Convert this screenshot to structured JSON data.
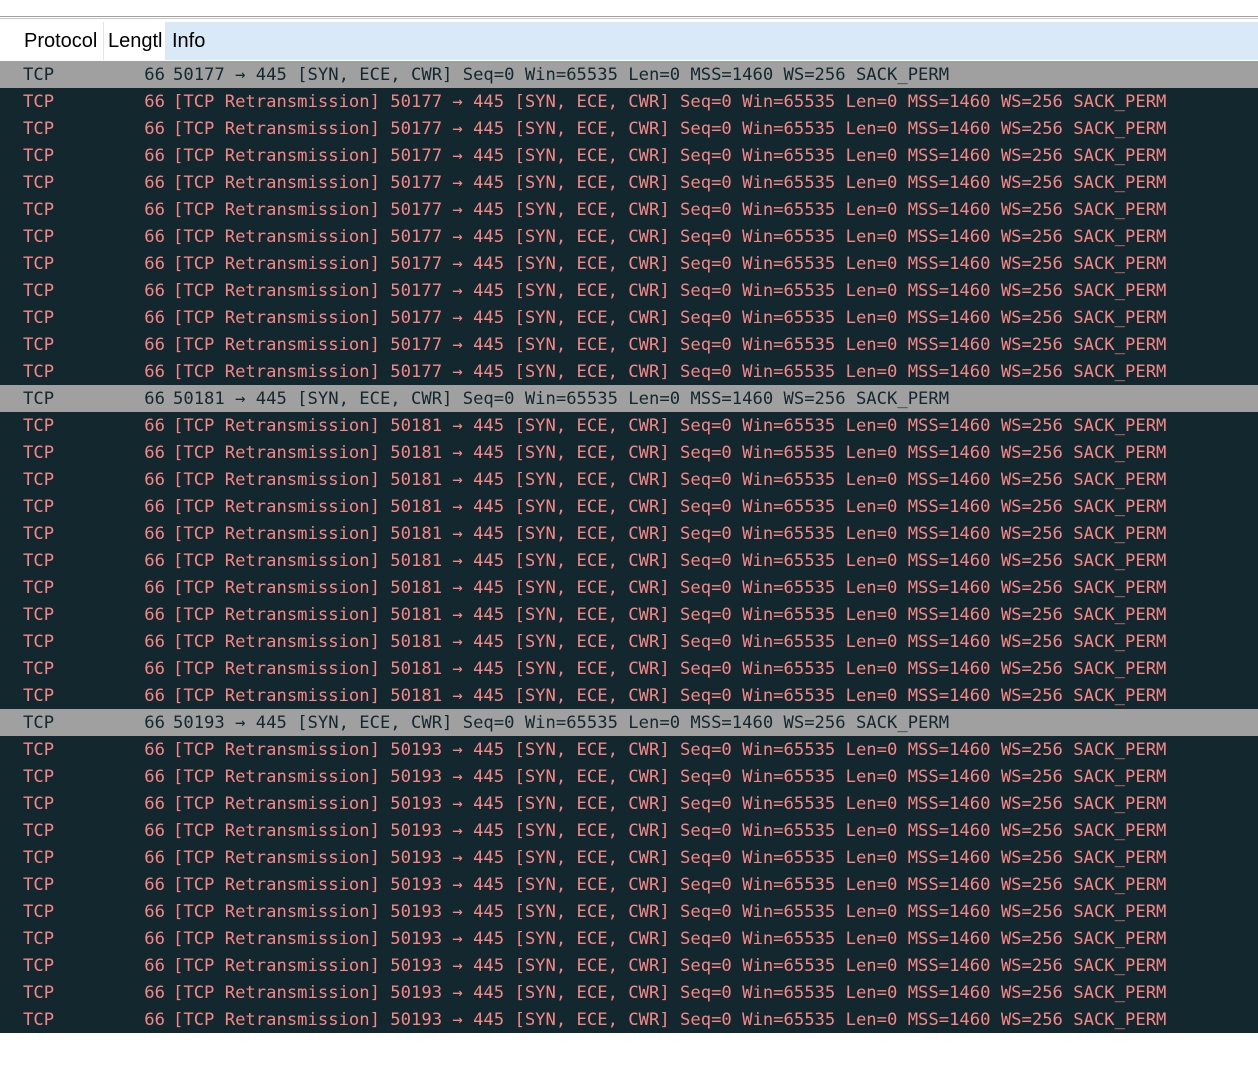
{
  "columns": {
    "protocol": "Protocol",
    "length": "Lengtl",
    "info": "Info"
  },
  "colors": {
    "retransmission_bg": "#12272e",
    "retransmission_fg": "#f78787",
    "normal_bg": "#a0a0a0",
    "normal_fg": "#12272e",
    "header_bg": "#d9e9f7"
  },
  "packets": [
    {
      "type": "syn",
      "protocol": "TCP",
      "length": "66",
      "info": "50177 → 445 [SYN, ECE, CWR] Seq=0 Win=65535 Len=0 MSS=1460 WS=256 SACK_PERM"
    },
    {
      "type": "retrans",
      "protocol": "TCP",
      "length": "66",
      "info": "[TCP Retransmission] 50177 → 445 [SYN, ECE, CWR] Seq=0 Win=65535 Len=0 MSS=1460 WS=256 SACK_PERM"
    },
    {
      "type": "retrans",
      "protocol": "TCP",
      "length": "66",
      "info": "[TCP Retransmission] 50177 → 445 [SYN, ECE, CWR] Seq=0 Win=65535 Len=0 MSS=1460 WS=256 SACK_PERM"
    },
    {
      "type": "retrans",
      "protocol": "TCP",
      "length": "66",
      "info": "[TCP Retransmission] 50177 → 445 [SYN, ECE, CWR] Seq=0 Win=65535 Len=0 MSS=1460 WS=256 SACK_PERM"
    },
    {
      "type": "retrans",
      "protocol": "TCP",
      "length": "66",
      "info": "[TCP Retransmission] 50177 → 445 [SYN, ECE, CWR] Seq=0 Win=65535 Len=0 MSS=1460 WS=256 SACK_PERM"
    },
    {
      "type": "retrans",
      "protocol": "TCP",
      "length": "66",
      "info": "[TCP Retransmission] 50177 → 445 [SYN, ECE, CWR] Seq=0 Win=65535 Len=0 MSS=1460 WS=256 SACK_PERM"
    },
    {
      "type": "retrans",
      "protocol": "TCP",
      "length": "66",
      "info": "[TCP Retransmission] 50177 → 445 [SYN, ECE, CWR] Seq=0 Win=65535 Len=0 MSS=1460 WS=256 SACK_PERM"
    },
    {
      "type": "retrans",
      "protocol": "TCP",
      "length": "66",
      "info": "[TCP Retransmission] 50177 → 445 [SYN, ECE, CWR] Seq=0 Win=65535 Len=0 MSS=1460 WS=256 SACK_PERM"
    },
    {
      "type": "retrans",
      "protocol": "TCP",
      "length": "66",
      "info": "[TCP Retransmission] 50177 → 445 [SYN, ECE, CWR] Seq=0 Win=65535 Len=0 MSS=1460 WS=256 SACK_PERM"
    },
    {
      "type": "retrans",
      "protocol": "TCP",
      "length": "66",
      "info": "[TCP Retransmission] 50177 → 445 [SYN, ECE, CWR] Seq=0 Win=65535 Len=0 MSS=1460 WS=256 SACK_PERM"
    },
    {
      "type": "retrans",
      "protocol": "TCP",
      "length": "66",
      "info": "[TCP Retransmission] 50177 → 445 [SYN, ECE, CWR] Seq=0 Win=65535 Len=0 MSS=1460 WS=256 SACK_PERM"
    },
    {
      "type": "retrans",
      "protocol": "TCP",
      "length": "66",
      "info": "[TCP Retransmission] 50177 → 445 [SYN, ECE, CWR] Seq=0 Win=65535 Len=0 MSS=1460 WS=256 SACK_PERM"
    },
    {
      "type": "syn",
      "protocol": "TCP",
      "length": "66",
      "info": "50181 → 445 [SYN, ECE, CWR] Seq=0 Win=65535 Len=0 MSS=1460 WS=256 SACK_PERM"
    },
    {
      "type": "retrans",
      "protocol": "TCP",
      "length": "66",
      "info": "[TCP Retransmission] 50181 → 445 [SYN, ECE, CWR] Seq=0 Win=65535 Len=0 MSS=1460 WS=256 SACK_PERM"
    },
    {
      "type": "retrans",
      "protocol": "TCP",
      "length": "66",
      "info": "[TCP Retransmission] 50181 → 445 [SYN, ECE, CWR] Seq=0 Win=65535 Len=0 MSS=1460 WS=256 SACK_PERM"
    },
    {
      "type": "retrans",
      "protocol": "TCP",
      "length": "66",
      "info": "[TCP Retransmission] 50181 → 445 [SYN, ECE, CWR] Seq=0 Win=65535 Len=0 MSS=1460 WS=256 SACK_PERM"
    },
    {
      "type": "retrans",
      "protocol": "TCP",
      "length": "66",
      "info": "[TCP Retransmission] 50181 → 445 [SYN, ECE, CWR] Seq=0 Win=65535 Len=0 MSS=1460 WS=256 SACK_PERM"
    },
    {
      "type": "retrans",
      "protocol": "TCP",
      "length": "66",
      "info": "[TCP Retransmission] 50181 → 445 [SYN, ECE, CWR] Seq=0 Win=65535 Len=0 MSS=1460 WS=256 SACK_PERM"
    },
    {
      "type": "retrans",
      "protocol": "TCP",
      "length": "66",
      "info": "[TCP Retransmission] 50181 → 445 [SYN, ECE, CWR] Seq=0 Win=65535 Len=0 MSS=1460 WS=256 SACK_PERM"
    },
    {
      "type": "retrans",
      "protocol": "TCP",
      "length": "66",
      "info": "[TCP Retransmission] 50181 → 445 [SYN, ECE, CWR] Seq=0 Win=65535 Len=0 MSS=1460 WS=256 SACK_PERM"
    },
    {
      "type": "retrans",
      "protocol": "TCP",
      "length": "66",
      "info": "[TCP Retransmission] 50181 → 445 [SYN, ECE, CWR] Seq=0 Win=65535 Len=0 MSS=1460 WS=256 SACK_PERM"
    },
    {
      "type": "retrans",
      "protocol": "TCP",
      "length": "66",
      "info": "[TCP Retransmission] 50181 → 445 [SYN, ECE, CWR] Seq=0 Win=65535 Len=0 MSS=1460 WS=256 SACK_PERM"
    },
    {
      "type": "retrans",
      "protocol": "TCP",
      "length": "66",
      "info": "[TCP Retransmission] 50181 → 445 [SYN, ECE, CWR] Seq=0 Win=65535 Len=0 MSS=1460 WS=256 SACK_PERM"
    },
    {
      "type": "retrans",
      "protocol": "TCP",
      "length": "66",
      "info": "[TCP Retransmission] 50181 → 445 [SYN, ECE, CWR] Seq=0 Win=65535 Len=0 MSS=1460 WS=256 SACK_PERM"
    },
    {
      "type": "syn",
      "protocol": "TCP",
      "length": "66",
      "info": "50193 → 445 [SYN, ECE, CWR] Seq=0 Win=65535 Len=0 MSS=1460 WS=256 SACK_PERM"
    },
    {
      "type": "retrans",
      "protocol": "TCP",
      "length": "66",
      "info": "[TCP Retransmission] 50193 → 445 [SYN, ECE, CWR] Seq=0 Win=65535 Len=0 MSS=1460 WS=256 SACK_PERM"
    },
    {
      "type": "retrans",
      "protocol": "TCP",
      "length": "66",
      "info": "[TCP Retransmission] 50193 → 445 [SYN, ECE, CWR] Seq=0 Win=65535 Len=0 MSS=1460 WS=256 SACK_PERM"
    },
    {
      "type": "retrans",
      "protocol": "TCP",
      "length": "66",
      "info": "[TCP Retransmission] 50193 → 445 [SYN, ECE, CWR] Seq=0 Win=65535 Len=0 MSS=1460 WS=256 SACK_PERM"
    },
    {
      "type": "retrans",
      "protocol": "TCP",
      "length": "66",
      "info": "[TCP Retransmission] 50193 → 445 [SYN, ECE, CWR] Seq=0 Win=65535 Len=0 MSS=1460 WS=256 SACK_PERM"
    },
    {
      "type": "retrans",
      "protocol": "TCP",
      "length": "66",
      "info": "[TCP Retransmission] 50193 → 445 [SYN, ECE, CWR] Seq=0 Win=65535 Len=0 MSS=1460 WS=256 SACK_PERM"
    },
    {
      "type": "retrans",
      "protocol": "TCP",
      "length": "66",
      "info": "[TCP Retransmission] 50193 → 445 [SYN, ECE, CWR] Seq=0 Win=65535 Len=0 MSS=1460 WS=256 SACK_PERM"
    },
    {
      "type": "retrans",
      "protocol": "TCP",
      "length": "66",
      "info": "[TCP Retransmission] 50193 → 445 [SYN, ECE, CWR] Seq=0 Win=65535 Len=0 MSS=1460 WS=256 SACK_PERM"
    },
    {
      "type": "retrans",
      "protocol": "TCP",
      "length": "66",
      "info": "[TCP Retransmission] 50193 → 445 [SYN, ECE, CWR] Seq=0 Win=65535 Len=0 MSS=1460 WS=256 SACK_PERM"
    },
    {
      "type": "retrans",
      "protocol": "TCP",
      "length": "66",
      "info": "[TCP Retransmission] 50193 → 445 [SYN, ECE, CWR] Seq=0 Win=65535 Len=0 MSS=1460 WS=256 SACK_PERM"
    },
    {
      "type": "retrans",
      "protocol": "TCP",
      "length": "66",
      "info": "[TCP Retransmission] 50193 → 445 [SYN, ECE, CWR] Seq=0 Win=65535 Len=0 MSS=1460 WS=256 SACK_PERM"
    },
    {
      "type": "retrans",
      "protocol": "TCP",
      "length": "66",
      "info": "[TCP Retransmission] 50193 → 445 [SYN, ECE, CWR] Seq=0 Win=65535 Len=0 MSS=1460 WS=256 SACK_PERM"
    }
  ]
}
